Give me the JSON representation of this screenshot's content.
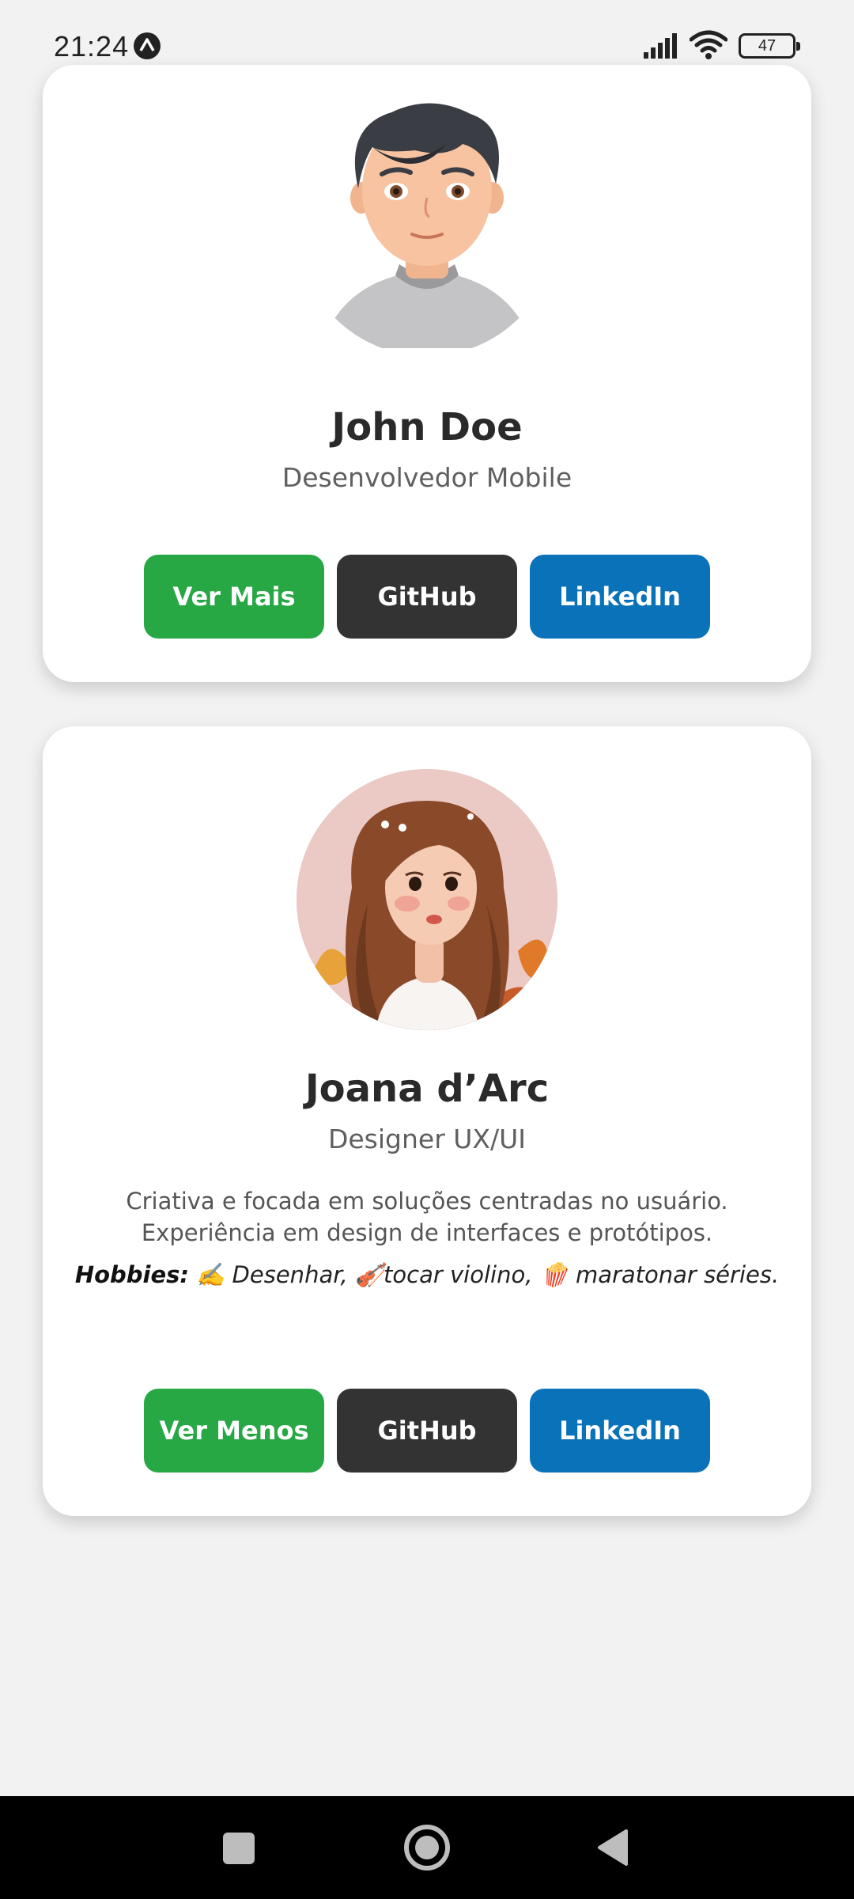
{
  "status_bar": {
    "time": "21:24",
    "battery": "47",
    "icons": [
      "app-notification-icon",
      "signal-icon",
      "wifi-icon",
      "battery-icon"
    ]
  },
  "cards": [
    {
      "name": "John Doe",
      "role": "Desenvolvedor Mobile",
      "avatar": "male-avatar-illustration",
      "buttons": {
        "toggle": "Ver Mais",
        "github": "GitHub",
        "linkedin": "LinkedIn"
      }
    },
    {
      "name": "Joana d’Arc",
      "role": "Designer UX/UI",
      "avatar": "female-avatar-illustration",
      "bio_line1": "Criativa e focada em soluções centradas no usuário.",
      "bio_line2": "Experiência em design de interfaces e protótipos.",
      "hobbies_label": "Hobbies:",
      "hobbies_text": "✍️ Desenhar, 🎻tocar violino, 🍿 maratonar séries.",
      "buttons": {
        "toggle": "Ver Menos",
        "github": "GitHub",
        "linkedin": "LinkedIn"
      }
    }
  ],
  "colors": {
    "green": "#28a745",
    "dark": "#333333",
    "blue": "#0a72b8",
    "background": "#f2f2f3"
  },
  "nav_bar": {
    "icons": [
      "recents-icon",
      "home-icon",
      "back-icon"
    ]
  }
}
